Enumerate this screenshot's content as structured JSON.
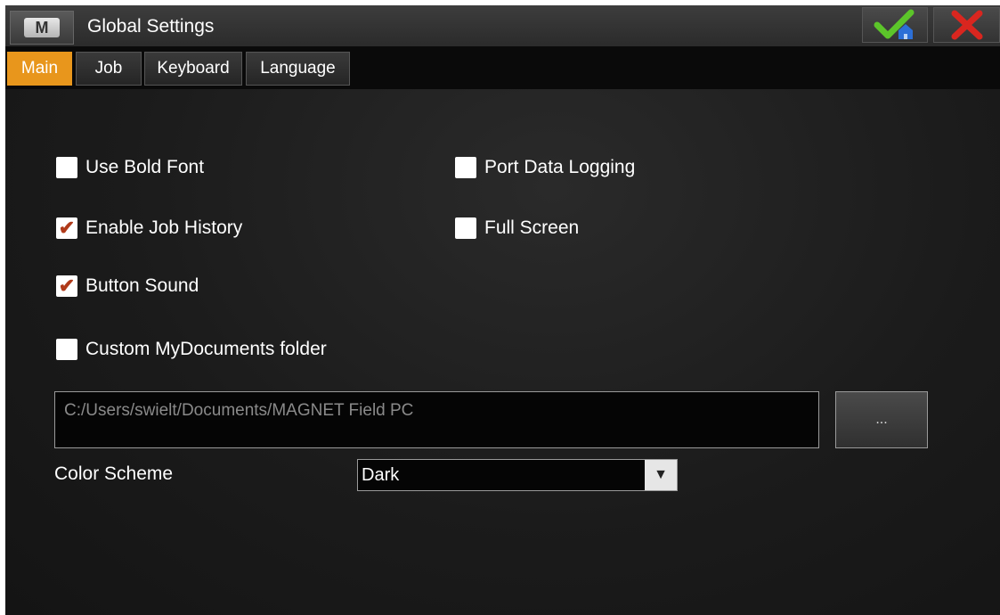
{
  "titlebar": {
    "logo_letter": "M",
    "title": "Global Settings",
    "confirm_icon": "check-home-icon",
    "close_icon": "close-x-icon"
  },
  "tabs": [
    {
      "label": "Main",
      "active": true
    },
    {
      "label": "Job",
      "active": false
    },
    {
      "label": "Keyboard",
      "active": false
    },
    {
      "label": "Language",
      "active": false
    }
  ],
  "options": {
    "use_bold_font": {
      "label": "Use Bold Font",
      "checked": false
    },
    "port_data_logging": {
      "label": "Port Data Logging",
      "checked": false
    },
    "enable_job_history": {
      "label": "Enable Job History",
      "checked": true
    },
    "full_screen": {
      "label": "Full Screen",
      "checked": false
    },
    "button_sound": {
      "label": "Button Sound",
      "checked": true
    },
    "custom_mydocuments_folder": {
      "label": "Custom MyDocuments folder",
      "checked": false
    }
  },
  "folder": {
    "path": "C:/Users/swielt/Documents/MAGNET Field PC",
    "browse_label": "..."
  },
  "color_scheme": {
    "label": "Color Scheme",
    "value": "Dark"
  },
  "colors": {
    "active_tab": "#e8961c",
    "check_mark": "#b03a1a",
    "confirm_green": "#5cc52a",
    "close_red": "#d9261f",
    "home_blue": "#2c6fd6"
  }
}
